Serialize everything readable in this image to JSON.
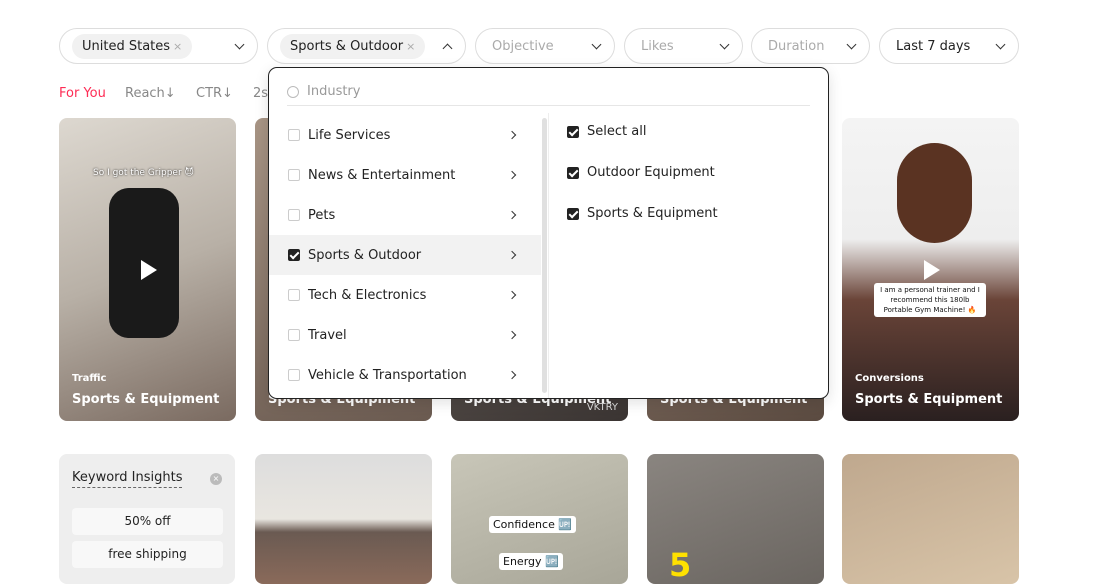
{
  "filters": {
    "country": {
      "value": "United States",
      "clear": "×"
    },
    "industry": {
      "value": "Sports & Outdoor",
      "clear": "×"
    },
    "objective": {
      "placeholder": "Objective"
    },
    "likes": {
      "placeholder": "Likes"
    },
    "duration": {
      "placeholder": "Duration"
    },
    "period": {
      "value": "Last 7 days"
    }
  },
  "sort_tabs": [
    {
      "label": "For You",
      "active": true
    },
    {
      "label": "Reach↓"
    },
    {
      "label": "CTR↓"
    },
    {
      "label": "2s"
    }
  ],
  "accent_color": "#fe2c55",
  "dropdown": {
    "search_placeholder": "Industry",
    "categories": [
      {
        "label": "Life Services",
        "checked": false
      },
      {
        "label": "News & Entertainment",
        "checked": false
      },
      {
        "label": "Pets",
        "checked": false
      },
      {
        "label": "Sports & Outdoor",
        "checked": true
      },
      {
        "label": "Tech & Electronics",
        "checked": false
      },
      {
        "label": "Travel",
        "checked": false
      },
      {
        "label": "Vehicle & Transportation",
        "checked": false
      }
    ],
    "subcategories": [
      {
        "label": "Select all",
        "checked": true
      },
      {
        "label": "Outdoor Equipment",
        "checked": true
      },
      {
        "label": "Sports & Equipment",
        "checked": true
      }
    ]
  },
  "videos": [
    {
      "tag": "Traffic",
      "title": "Sports & Equipment",
      "overlay": "So I got the Gripper 😈"
    },
    {
      "tag": "",
      "title": "Sports & Equipment"
    },
    {
      "tag": "",
      "title": "Sports & Equipment",
      "watermark": "VKTRY"
    },
    {
      "tag": "",
      "title": "Sports & Equipment"
    },
    {
      "tag": "Conversions",
      "title": "Sports & Equipment",
      "overlay": "I am a personal trainer and I recommend this 180lb Portable Gym Machine! 🔥"
    }
  ],
  "keyword_insights": {
    "title": "Keyword Insights",
    "keywords": [
      "50% off",
      "free shipping"
    ]
  },
  "row2_overlays": {
    "confidence": "Confidence 🆙",
    "energy": "Energy 🆙",
    "number": "5"
  }
}
